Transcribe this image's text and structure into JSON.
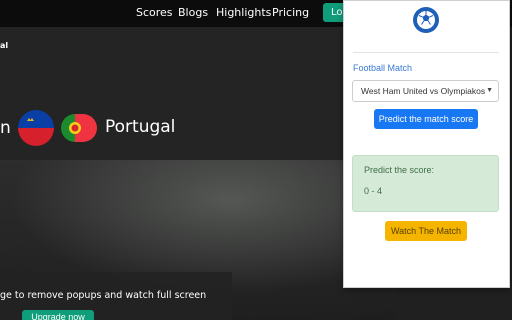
{
  "site": {
    "nav": [
      "Scores",
      "Blogs",
      "Highlights",
      "Pricing"
    ],
    "login_label": "Log",
    "logo_text": "al",
    "team_left": "n",
    "team_right": "Portugal",
    "upgrade_text": "ge to remove popups and watch full screen",
    "upgrade_button": "Upgrade now"
  },
  "popup": {
    "logo_icon": "soccer-ball-icon",
    "field_label": "Football Match",
    "selected_match": "West Ham United vs Olympiakos",
    "predict_button": "Predict the match score",
    "result_label": "Predict the score:",
    "result_value": "0 - 4",
    "watch_button": "Watch The Match"
  },
  "colors": {
    "primary": "#1877f2",
    "accent_label": "#3a7bd5",
    "success_bg": "#d5ebd8",
    "warning": "#f4b400",
    "site_accent": "#0f9d7a"
  }
}
